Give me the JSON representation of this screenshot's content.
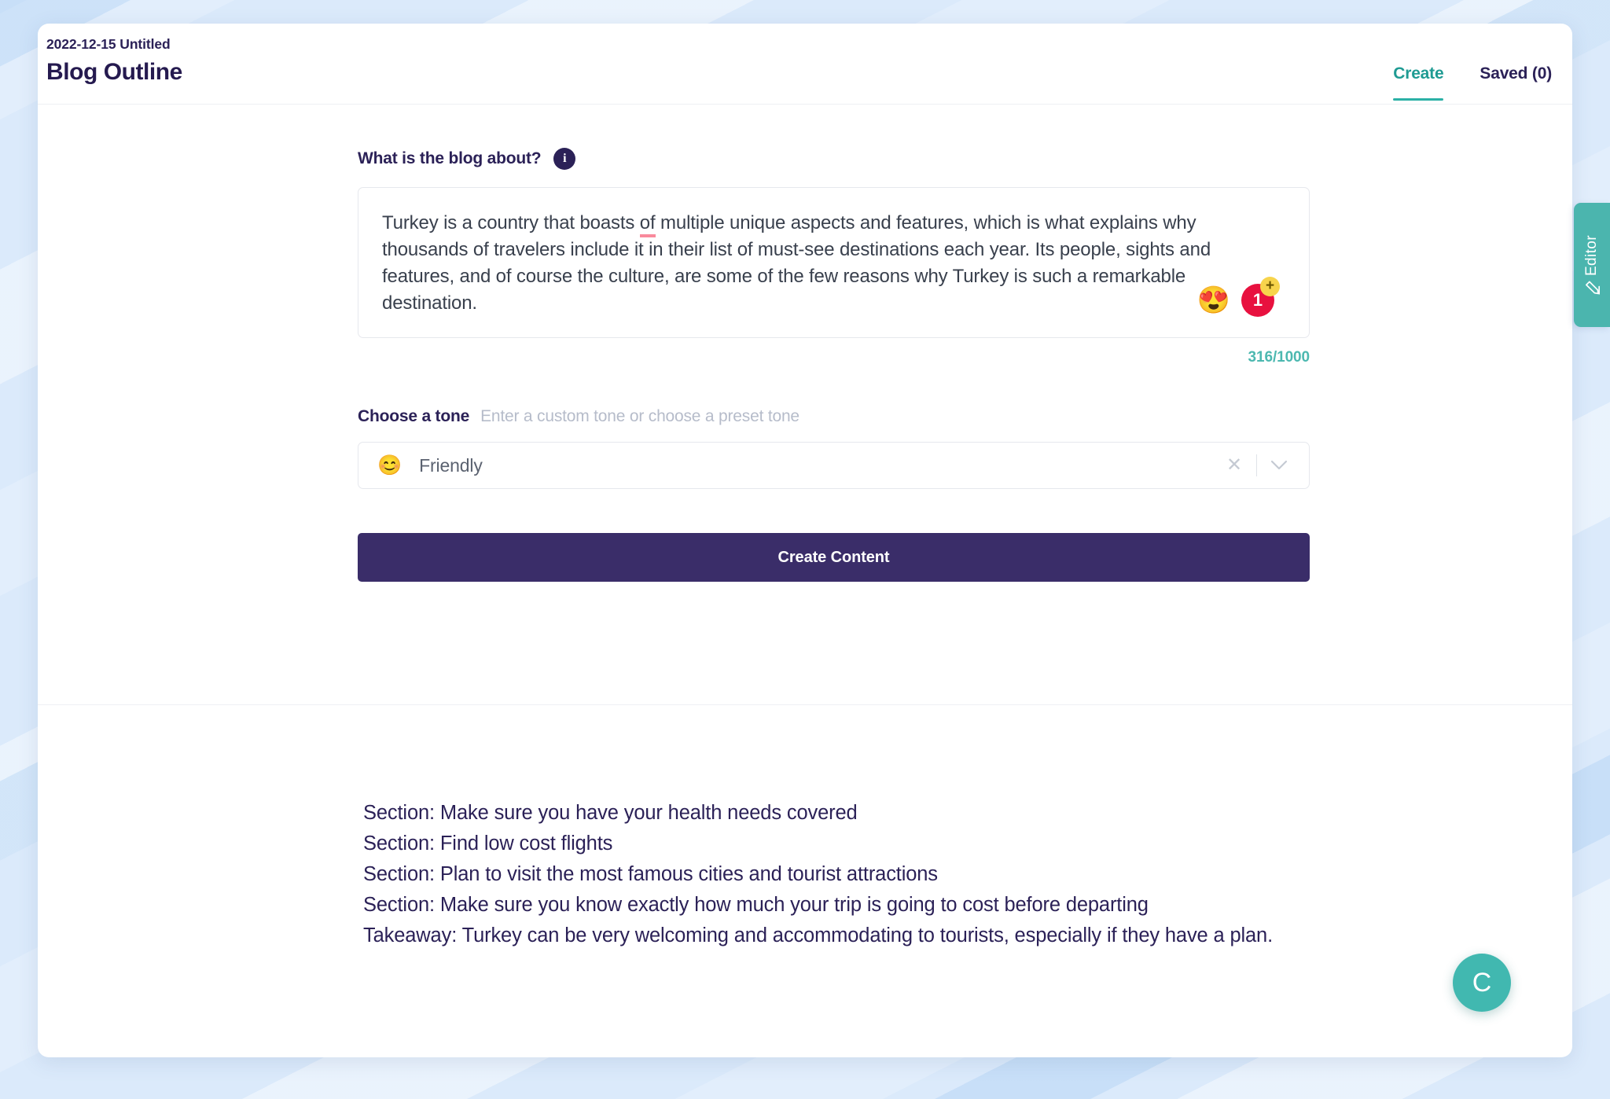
{
  "header": {
    "doc_meta": "2022-12-15 Untitled",
    "doc_title": "Blog Outline",
    "tabs": [
      {
        "label": "Create",
        "active": true
      },
      {
        "label": "Saved (0)",
        "active": false
      }
    ]
  },
  "form": {
    "prompt_label": "What is the blog about?",
    "info_icon": "info-icon",
    "prompt_text_part1": "Turkey is a country that boasts ",
    "prompt_text_misspelled": "of",
    "prompt_text_part2": " multiple unique aspects and features, which is what explains why thousands of travelers include it in their list of must-see destinations each year. Its people, sights and features, and of course the culture, are some of the few reasons why Turkey is such a remarkable destination.",
    "reaction_emoji": "😍",
    "reaction_count": "1",
    "reaction_add": "+",
    "char_counter": "316/1000",
    "tone_label": "Choose a tone",
    "tone_hint": "Enter a custom tone or choose a preset tone",
    "tone_emoji": "😊",
    "tone_value": "Friendly",
    "tone_placeholder": "Enter a custom tone or choose a preset tone",
    "clear_icon": "✕",
    "chevron_icon": "⌄",
    "create_button": "Create Content"
  },
  "output": {
    "lines": [
      "Section: Make sure you have your health needs covered",
      "Section: Find low cost flights",
      "Section: Plan to visit the most famous cities and tourist attractions",
      "Section: Make sure you know exactly how much your trip is going to cost before departing",
      "Takeaway: Turkey can be very welcoming and accommodating to tourists, especially if they have a plan."
    ]
  },
  "editor_tab": {
    "label": "Editor",
    "icon": "pencil-icon"
  },
  "fab": {
    "label": "C"
  },
  "colors": {
    "accent_teal": "#2bb0a6",
    "navy": "#2b2157",
    "button_purple": "#3a2d69",
    "badge_red": "#e8113f",
    "badge_yellow": "#f7d44c",
    "spell_underline": "#f98a9c",
    "background_blue": "#dbeafb"
  }
}
